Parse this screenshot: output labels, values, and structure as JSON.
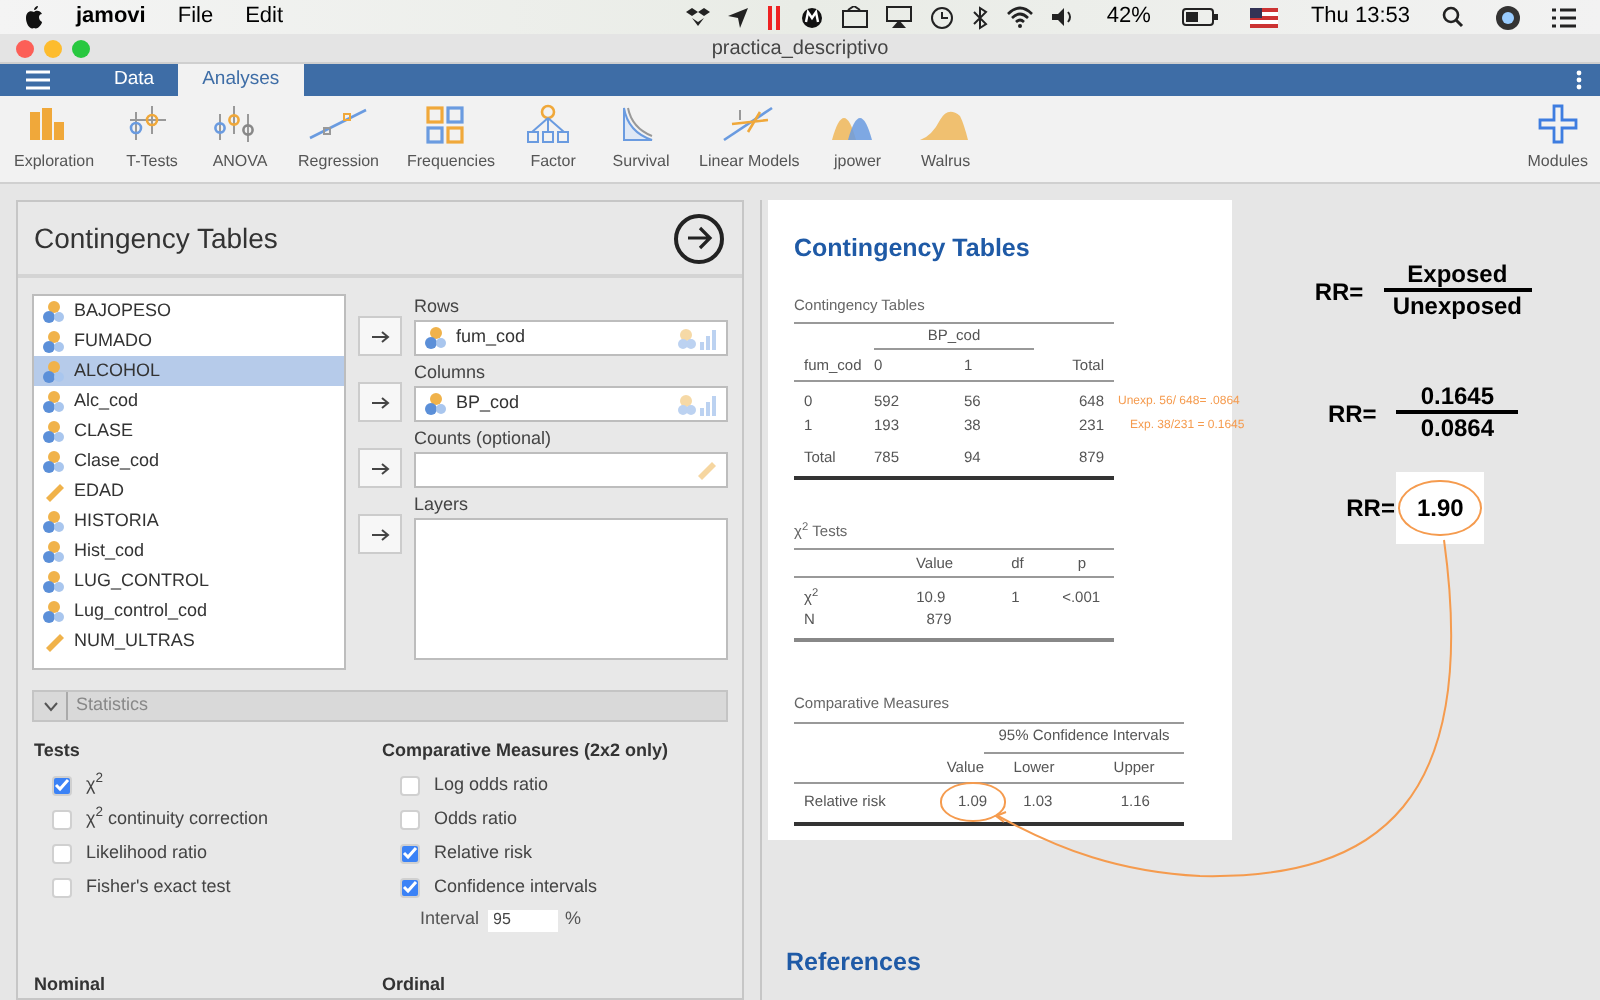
{
  "menubar": {
    "app": "jamovi",
    "menus": [
      "File",
      "Edit"
    ],
    "battery": "42%",
    "clock": "Thu 13:53"
  },
  "window": {
    "title": "practica_descriptivo"
  },
  "tabs": [
    {
      "label": "Data",
      "selected": false
    },
    {
      "label": "Analyses",
      "selected": true
    }
  ],
  "ribbon": [
    "Exploration",
    "T-Tests",
    "ANOVA",
    "Regression",
    "Frequencies",
    "Factor",
    "Survival",
    "Linear Models",
    "jpower",
    "Walrus"
  ],
  "modules": "Modules",
  "analysis": {
    "title": "Contingency Tables",
    "variables": [
      {
        "name": "BAJOPESO",
        "kind": "nominal",
        "selected": false
      },
      {
        "name": "FUMADO",
        "kind": "nominal",
        "selected": false
      },
      {
        "name": "ALCOHOL",
        "kind": "nominal",
        "selected": true
      },
      {
        "name": "Alc_cod",
        "kind": "nominal",
        "selected": false
      },
      {
        "name": "CLASE",
        "kind": "nominal",
        "selected": false
      },
      {
        "name": "Clase_cod",
        "kind": "nominal",
        "selected": false
      },
      {
        "name": "EDAD",
        "kind": "continuous",
        "selected": false
      },
      {
        "name": "HISTORIA",
        "kind": "nominal",
        "selected": false
      },
      {
        "name": "Hist_cod",
        "kind": "nominal",
        "selected": false
      },
      {
        "name": "LUG_CONTROL",
        "kind": "nominal",
        "selected": false
      },
      {
        "name": "Lug_control_cod",
        "kind": "nominal",
        "selected": false
      },
      {
        "name": "NUM_ULTRAS",
        "kind": "continuous",
        "selected": false
      }
    ],
    "targets": [
      {
        "label": "Rows",
        "value": "fum_cod",
        "kind": "nominal"
      },
      {
        "label": "Columns",
        "value": "BP_cod",
        "kind": "nominal"
      },
      {
        "label": "Counts (optional)",
        "kind": "counts"
      },
      {
        "label": "Layers",
        "kind": "list"
      }
    ],
    "section": {
      "label": "Statistics",
      "expanded": true
    },
    "tests": {
      "heading": "Tests",
      "options": [
        {
          "label": "χ$^{2}$",
          "checked": true
        },
        {
          "label": "χ$^{2}$ continuity correction",
          "checked": false
        },
        {
          "label": "Likelihood ratio",
          "checked": false
        },
        {
          "label": "Fisher's exact test",
          "checked": false
        }
      ]
    },
    "measures": {
      "heading": "Comparative Measures (2x2 only)",
      "options": [
        {
          "label": "Log odds ratio",
          "checked": false
        },
        {
          "label": "Odds ratio",
          "checked": false
        },
        {
          "label": "Relative risk",
          "checked": true
        },
        {
          "label": "Confidence intervals",
          "checked": true
        }
      ],
      "interval": {
        "label": "Interval",
        "value": "95",
        "unit": "%"
      }
    },
    "footer_headings": [
      "Nominal",
      "Ordinal"
    ]
  },
  "results": {
    "title": "Contingency Tables",
    "contingency": {
      "caption": "Contingency Tables",
      "group_header": "BP_cod",
      "columns": [
        "fum_cod",
        "0",
        "1",
        "Total"
      ],
      "rows": [
        {
          "cells": [
            "0",
            "592",
            "56",
            "648"
          ],
          "note": "Unexp. 56/ 648= .0864"
        },
        {
          "cells": [
            "1",
            "193",
            "38",
            "231"
          ],
          "note": "Exp. 38/231 = 0.1645"
        },
        {
          "cells": [
            "Total",
            "785",
            "94",
            "879"
          ]
        }
      ]
    },
    "chi": {
      "caption": "χ$^{2}$ Tests",
      "columns": [
        "Value",
        "df",
        "p"
      ],
      "rows": [
        {
          "label": "χ$^{2}$",
          "cells": [
            "10.9",
            "1",
            "<.001"
          ]
        },
        {
          "label": "N",
          "cells": [
            "879"
          ]
        }
      ]
    },
    "measures": {
      "caption": "Comparative Measures",
      "group_header": "95% Confidence Intervals",
      "columns": [
        "Value",
        "Lower",
        "Upper"
      ],
      "rows": [
        {
          "label": "Relative risk",
          "cells": [
            "1.09",
            "1.03",
            "1.16"
          ]
        }
      ]
    },
    "references": "References"
  },
  "formulas": [
    {
      "kind": "fraction",
      "label": "RR=",
      "numerator": "Exposed",
      "denominator": "Unexposed"
    },
    {
      "kind": "fraction",
      "label": "RR=",
      "numerator": "0.1645",
      "denominator": "0.0864"
    },
    {
      "kind": "result",
      "label": "RR=",
      "value": "1.90"
    }
  ]
}
